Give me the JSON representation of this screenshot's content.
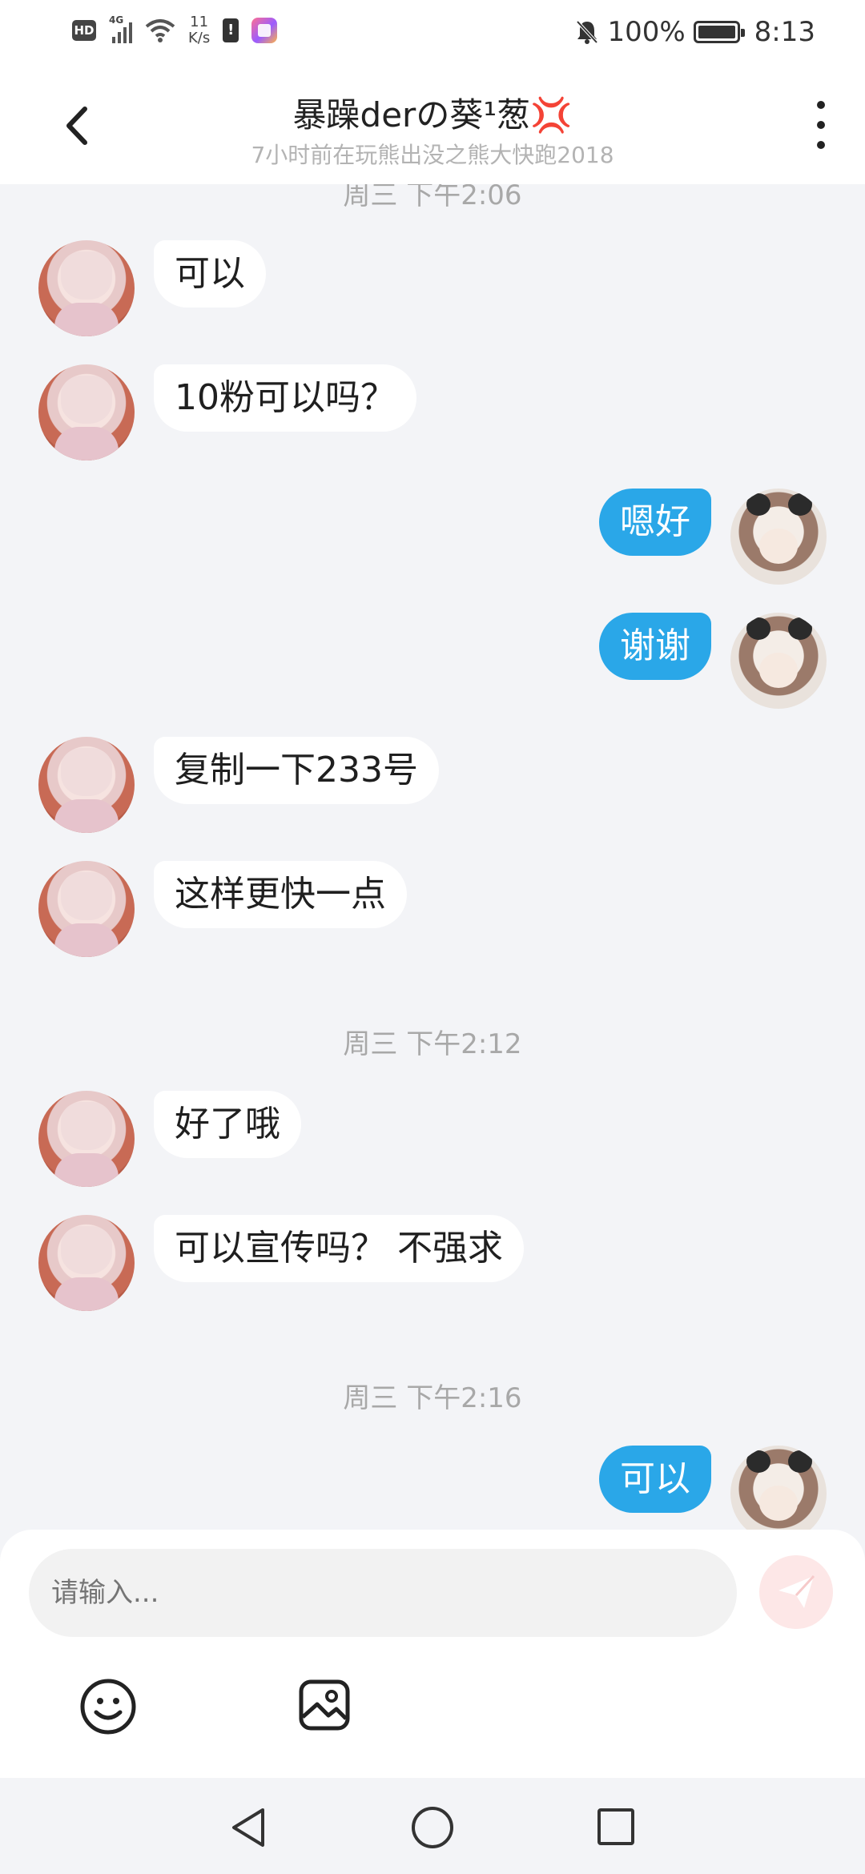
{
  "status_bar": {
    "hd": "HD",
    "network": "4G",
    "speed_value": "11",
    "speed_unit": "K/s",
    "alert": "!",
    "battery": "100%",
    "time": "8:13"
  },
  "header": {
    "title": "暴躁derの葵¹葱💢",
    "subtitle": "7小时前在玩熊出没之熊大快跑2018"
  },
  "chat": {
    "timestamps": [
      "周三 下午2:06",
      "周三 下午2:12",
      "周三 下午2:16"
    ],
    "messages": [
      {
        "from": "other",
        "text": "可以"
      },
      {
        "from": "other",
        "text": "10粉可以吗？"
      },
      {
        "from": "me",
        "text": "嗯好"
      },
      {
        "from": "me",
        "text": "谢谢"
      },
      {
        "from": "other",
        "text": "复制一下233号"
      },
      {
        "from": "other",
        "text": "这样更快一点"
      },
      {
        "from": "other",
        "text": "好了哦"
      },
      {
        "from": "other",
        "text": "可以宣传吗？ 不强求"
      },
      {
        "from": "me",
        "text": "可以"
      }
    ]
  },
  "input": {
    "placeholder": "请输入..."
  },
  "colors": {
    "my_bubble": "#2aa7e8",
    "other_bubble": "#ffffff",
    "background": "#f3f4f7",
    "send_button": "#fde7e7"
  },
  "icons": [
    "back-arrow-icon",
    "more-vertical-icon",
    "send-icon",
    "emoji-icon",
    "image-icon",
    "nav-back-icon",
    "nav-home-icon",
    "nav-recent-icon"
  ]
}
